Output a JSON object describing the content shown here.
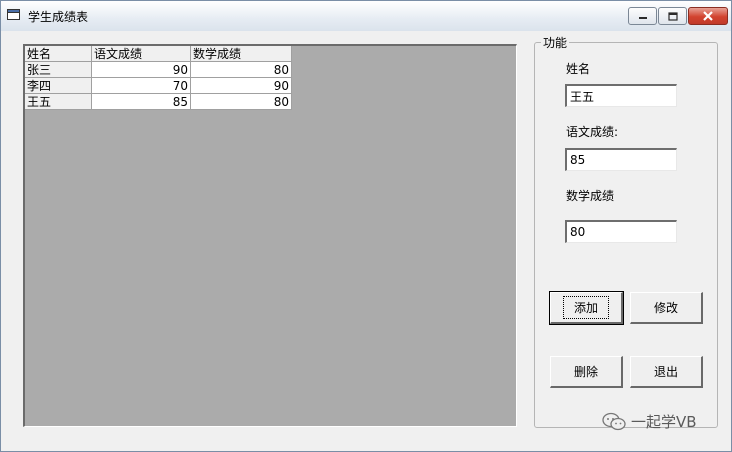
{
  "window": {
    "title": "学生成绩表"
  },
  "grid": {
    "headers": [
      "姓名",
      "语文成绩",
      "数学成绩"
    ],
    "rows": [
      [
        "张三",
        "90",
        "80"
      ],
      [
        "李四",
        "70",
        "90"
      ],
      [
        "王五",
        "85",
        "80"
      ]
    ]
  },
  "panel": {
    "legend": "功能",
    "name_label": "姓名",
    "name_value": "王五",
    "chinese_label": "语文成绩:",
    "chinese_value": "85",
    "math_label": "数学成绩",
    "math_value": "80"
  },
  "buttons": {
    "add": "添加",
    "edit": "修改",
    "delete": "删除",
    "exit": "退出"
  },
  "watermark": {
    "text": "一起学VB"
  },
  "icons": {
    "app": "window-icon",
    "minimize": "minimize-icon",
    "maximize": "maximize-icon",
    "close": "close-icon",
    "watermark": "wechat-icon"
  },
  "colors": {
    "close": "#c13a2a",
    "grid_bg": "#ababab"
  }
}
